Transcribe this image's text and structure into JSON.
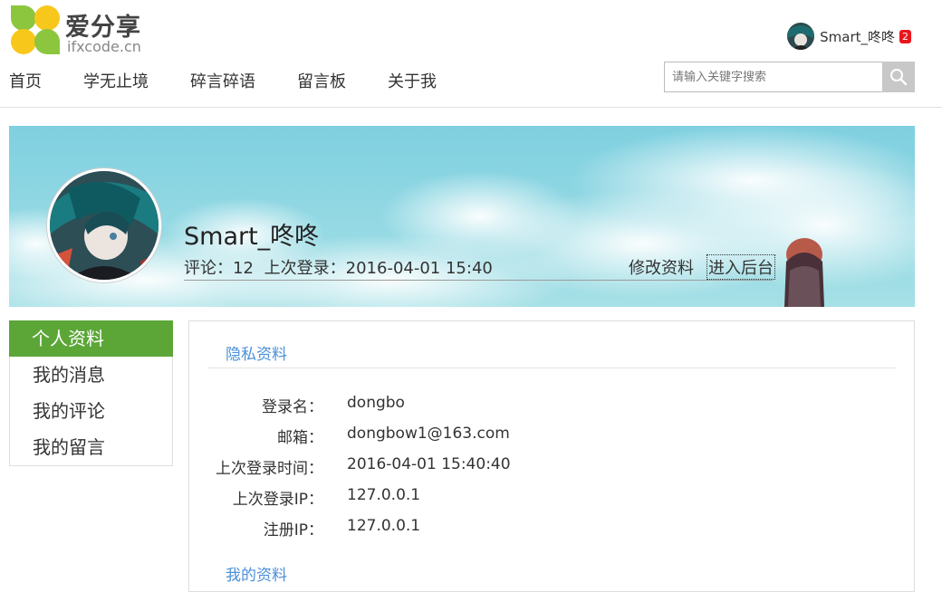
{
  "brand": {
    "title": "爱分享",
    "subtitle": "ifxcode.cn"
  },
  "user": {
    "name": "Smart_咚咚",
    "notifications": "2"
  },
  "nav": {
    "items": [
      "首页",
      "学无止境",
      "碎言碎语",
      "留言板",
      "关于我"
    ]
  },
  "search": {
    "placeholder": "请输入关键字搜索"
  },
  "profile": {
    "name": "Smart_咚咚",
    "comments_label": "评论：12",
    "last_login_label": "上次登录：2016-04-01 15:40",
    "edit_link": "修改资料",
    "admin_link": "进入后台"
  },
  "sidebar": {
    "items": [
      "个人资料",
      "我的消息",
      "我的评论",
      "我的留言"
    ],
    "active_index": 0
  },
  "privacy": {
    "title": "隐私资料",
    "fields": [
      {
        "label": "登录名：",
        "value": "dongbo"
      },
      {
        "label": "邮箱：",
        "value": "dongbow1@163.com"
      },
      {
        "label": "上次登录时间：",
        "value": "2016-04-01 15:40:40"
      },
      {
        "label": "上次登录IP：",
        "value": "127.0.0.1"
      },
      {
        "label": "注册IP：",
        "value": "127.0.0.1"
      }
    ]
  },
  "my_profile": {
    "title": "我的资料"
  },
  "colors": {
    "accent_green": "#5ca638",
    "link_blue": "#4a90d9",
    "badge_red": "#e8161d"
  }
}
